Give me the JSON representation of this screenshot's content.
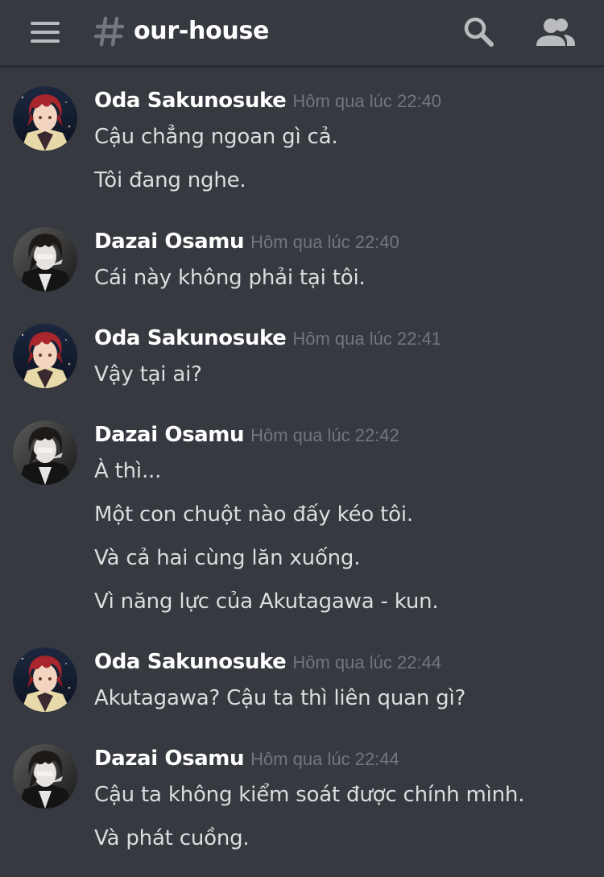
{
  "header": {
    "menu_icon": "hamburger-menu-icon",
    "channel_icon": "hash-icon",
    "channel_name": "our-house",
    "search_icon": "search-icon",
    "members_icon": "members-icon"
  },
  "colors": {
    "background": "#36393f",
    "author": "#ffffff",
    "message_text": "#dcddde",
    "timestamp": "#72767d",
    "icon": "#b9bbbe"
  },
  "messages": [
    {
      "author": "Oda Sakunosuke",
      "avatar": "oda-avatar",
      "timestamp": "Hôm qua lúc 22:40",
      "lines": [
        "Cậu chẳng ngoan gì cả.",
        "Tôi đang nghe."
      ]
    },
    {
      "author": "Dazai Osamu",
      "avatar": "dazai-avatar",
      "timestamp": "Hôm qua lúc 22:40",
      "lines": [
        "Cái này không phải tại tôi."
      ]
    },
    {
      "author": "Oda Sakunosuke",
      "avatar": "oda-avatar",
      "timestamp": "Hôm qua lúc 22:41",
      "lines": [
        "Vậy tại ai?"
      ]
    },
    {
      "author": "Dazai Osamu",
      "avatar": "dazai-avatar",
      "timestamp": "Hôm qua lúc 22:42",
      "lines": [
        "À thì...",
        "Một con chuột nào đấy kéo tôi.",
        "Và cả hai cùng lăn xuống.",
        "Vì năng lực của Akutagawa - kun."
      ]
    },
    {
      "author": "Oda Sakunosuke",
      "avatar": "oda-avatar",
      "timestamp": "Hôm qua lúc 22:44",
      "lines": [
        "Akutagawa? Cậu ta thì liên quan gì?"
      ]
    },
    {
      "author": "Dazai Osamu",
      "avatar": "dazai-avatar",
      "timestamp": "Hôm qua lúc 22:44",
      "lines": [
        "Cậu ta không kiểm soát được chính mình.",
        "Và phát cuồng."
      ]
    }
  ]
}
